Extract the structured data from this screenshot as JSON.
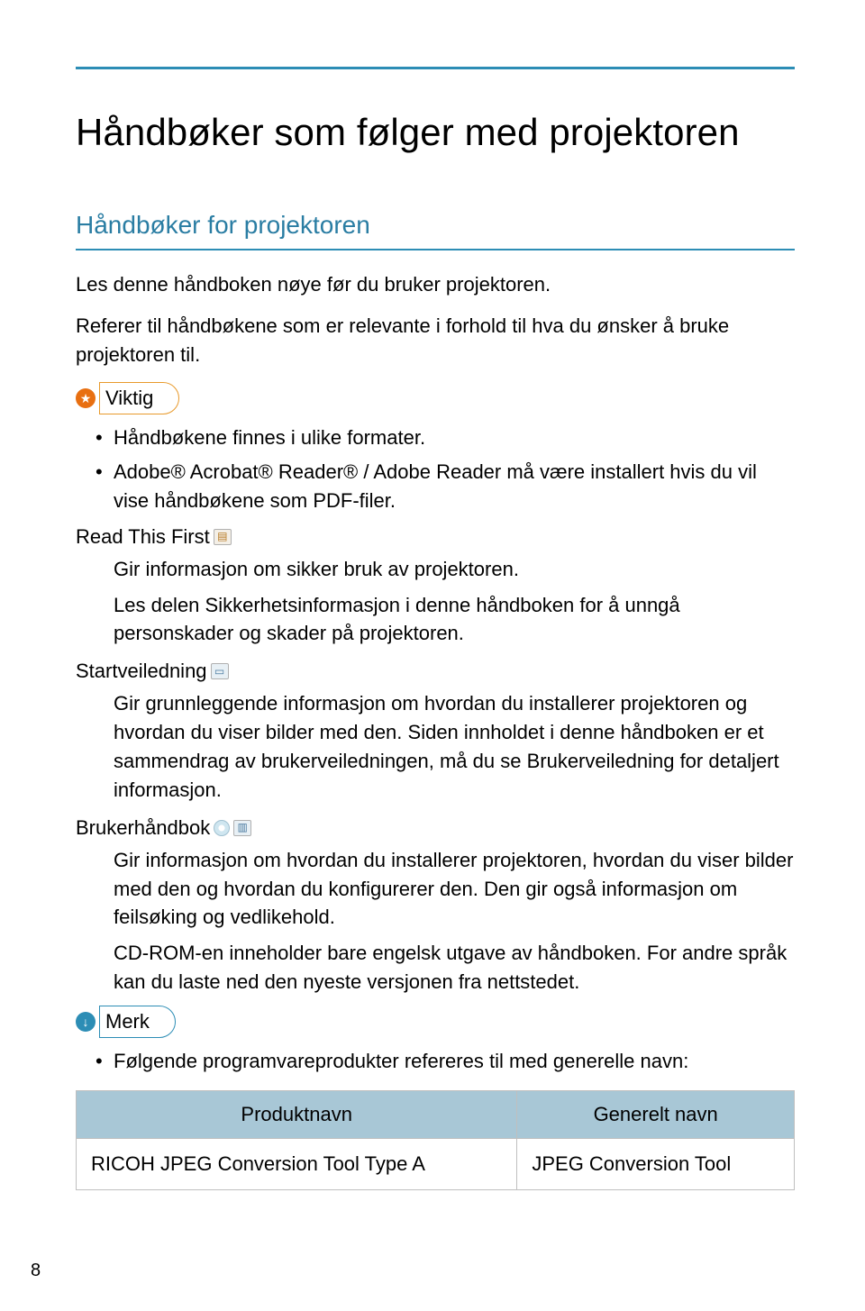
{
  "page_number": "8",
  "h1": "Håndbøker som følger med projektoren",
  "h2": "Håndbøker for projektoren",
  "intro1": "Les denne håndboken nøye før du bruker projektoren.",
  "intro2": "Referer til håndbøkene som er relevante i forhold til hva du ønsker å bruke projektoren til.",
  "viktig_label": "Viktig",
  "viktig_bullets": [
    "Håndbøkene finnes i ulike formater.",
    "Adobe® Acrobat® Reader® / Adobe Reader må være installert hvis du vil vise håndbøkene som PDF-filer."
  ],
  "sections": [
    {
      "head": "Read This First",
      "paras": [
        "Gir informasjon om sikker bruk av projektoren.",
        "Les delen Sikkerhetsinformasjon i denne håndboken for å unngå personskader og skader på projektoren."
      ]
    },
    {
      "head": "Startveiledning",
      "paras": [
        "Gir grunnleggende informasjon om hvordan du installerer projektoren og hvordan du viser bilder med den. Siden innholdet i denne håndboken er et sammendrag av brukerveiledningen, må du se Brukerveiledning for detaljert informasjon."
      ]
    },
    {
      "head": "Brukerhåndbok",
      "paras": [
        "Gir informasjon om hvordan du installerer projektoren, hvordan du viser bilder med den og hvordan du konfigurerer den. Den gir også informasjon om feilsøking og vedlikehold.",
        "CD-ROM-en inneholder bare engelsk utgave av håndboken. For andre språk kan du laste ned den nyeste versjonen fra nettstedet."
      ]
    }
  ],
  "merk_label": "Merk",
  "merk_bullet": "Følgende programvareprodukter refereres til med generelle navn:",
  "table": {
    "headers": [
      "Produktnavn",
      "Generelt navn"
    ],
    "row": [
      "RICOH JPEG Conversion Tool Type A",
      "JPEG Conversion Tool"
    ]
  }
}
